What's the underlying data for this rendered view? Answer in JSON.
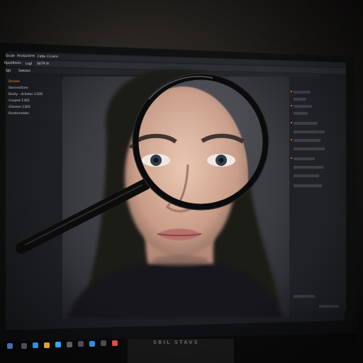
{
  "screen": {
    "menu_items": [
      "Ocole",
      "Aronjustres",
      "Fdlte",
      "Crcolre"
    ],
    "toolbar_items": [
      "Rpoidtions",
      "Lsgl",
      "SbTP:dl"
    ],
    "option_tabs": [
      "Sjtl",
      "Swkaos"
    ],
    "layers": [
      "Dcreon",
      "Oonnectiore",
      "Dnely · dcliotos 132D",
      "Conjest 1302",
      "Citerem 1302",
      "Ocatoreotwn"
    ]
  },
  "monitor_brand": "SBIL STAVS"
}
